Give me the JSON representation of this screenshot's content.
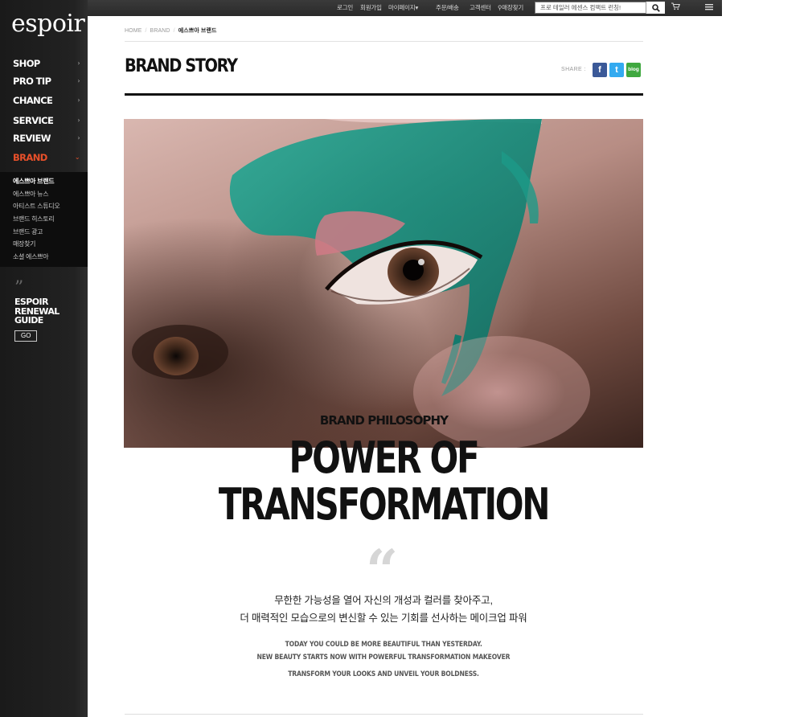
{
  "brand": {
    "logo": "espoir"
  },
  "topbar": {
    "links": [
      "로그인",
      "회원가입",
      "마이페이지",
      "주문/배송",
      "고객센터",
      "매장찾기"
    ],
    "mypage_caret": "▾",
    "search_value": "프로 테일러 에센스 컴팩트 런칭!",
    "search_icon": "search-icon",
    "cart_icon": "cart-icon",
    "menu_icon": "menu-icon",
    "pin": "⚲"
  },
  "sidebar": {
    "nav": [
      {
        "label": "SHOP",
        "arrow": "›"
      },
      {
        "label": "PRO TIP",
        "arrow": "›"
      },
      {
        "label": "CHANCE",
        "arrow": "›"
      },
      {
        "label": "SERVICE",
        "arrow": "›"
      },
      {
        "label": "REVIEW",
        "arrow": "›"
      },
      {
        "label": "BRAND",
        "arrow": "⌄"
      }
    ],
    "sub": [
      "에스쁘아 브랜드",
      "에스쁘아 뉴스",
      "아티스트 스튜디오",
      "브랜드 히스토리",
      "브랜드 광고",
      "매장찾기",
      "소셜 에스쁘아"
    ],
    "guide": {
      "quote": "”",
      "line1": "ESPOIR",
      "line2": "RENEWAL",
      "line3": "GUIDE",
      "go": "GO"
    }
  },
  "breadcrumb": {
    "home": "HOME",
    "sep": "/",
    "section": "BRAND",
    "current": "에스쁘아 브랜드"
  },
  "page": {
    "title": "BRAND STORY",
    "share_label": "SHARE :",
    "share": {
      "facebook": "f",
      "twitter": "t",
      "blog": "blog"
    }
  },
  "content": {
    "subtitle": "BRAND PHILOSOPHY",
    "headline1": "POWER OF",
    "headline2": "TRANSFORMATION",
    "quote_mark": "“",
    "kr1": "무한한 가능성을 열어 자신의 개성과 컬러를 찾아주고,",
    "kr2": "더 매력적인 모습으로의 변신할 수 있는 기회를 선사하는 메이크업 파워",
    "en1": "TODAY YOU COULD BE MORE BEAUTIFUL THAN YESTERDAY.",
    "en2": "NEW BEAUTY STARTS NOW WITH POWERFUL TRANSFORMATION MAKEOVER",
    "en3": "TRANSFORM YOUR LOOKS AND UNVEIL YOUR BOLDNESS."
  },
  "colors": {
    "accent": "#e8502a",
    "facebook": "#3b5998",
    "twitter": "#33aaf0",
    "blog": "#3fa83f",
    "paint": "#1f9e8e"
  }
}
